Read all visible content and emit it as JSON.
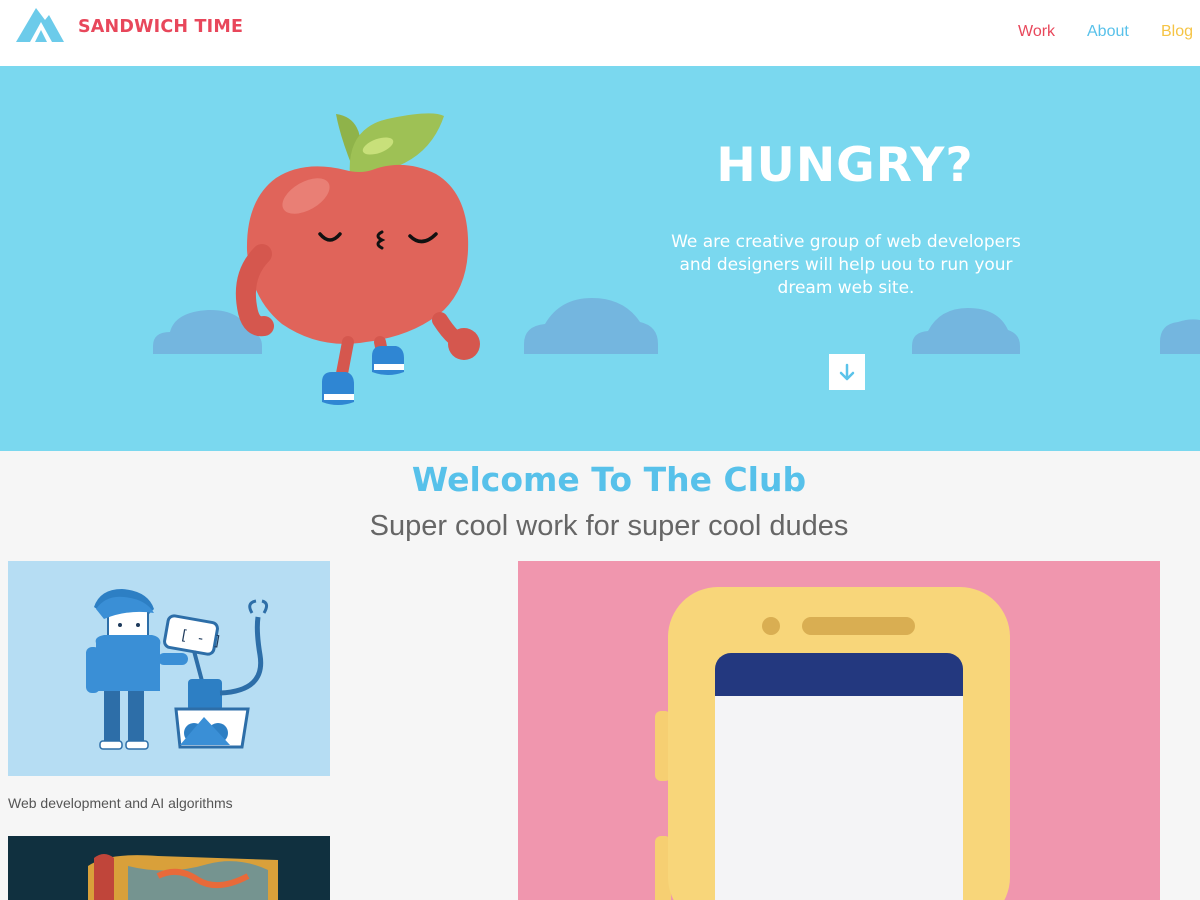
{
  "header": {
    "logo_icon": "mountain-logo-icon",
    "brand": "SANDWICH TIME",
    "nav": {
      "work": "Work",
      "about": "About",
      "blog": "Blog"
    }
  },
  "hero": {
    "title": "HUNGRY?",
    "text": "We are creative group of web developers and designers will help uou to run your dream web site.",
    "scroll_icon": "arrow-down-icon"
  },
  "intro": {
    "title": "Welcome To The Club",
    "tagline": "Super cool work for super cool dudes"
  },
  "works": [
    {
      "caption": "Web development and AI algorithms"
    }
  ],
  "colors": {
    "brand_red": "#e8475b",
    "about_blue": "#58c1ea",
    "blog_yellow": "#f5c445",
    "hero_bg": "#7ad8ef",
    "welcome_blue": "#57c1ea",
    "phone_card_bg": "#f096ae"
  }
}
